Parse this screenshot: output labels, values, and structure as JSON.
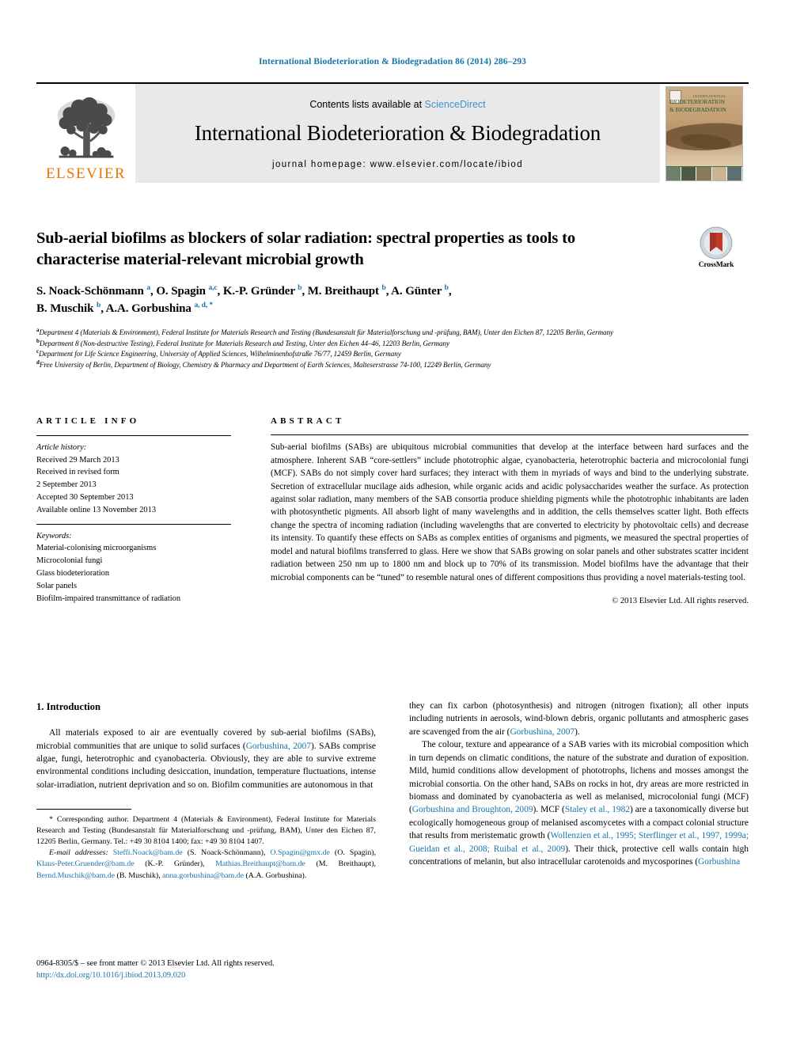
{
  "running_head": "International Biodeterioration & Biodegradation 86 (2014) 286–293",
  "masthead": {
    "publisher_wordmark": "ELSEVIER",
    "contents_prefix": "Contents lists available at ",
    "contents_link": "ScienceDirect",
    "journal_name": "International Biodeterioration & Biodegradation",
    "homepage": "journal homepage: www.elsevier.com/locate/ibiod",
    "cover_title_top": "INTERNATIONAL",
    "cover_title_line1": "BIODETERIORATION",
    "cover_title_line2": "& BIODEGRADATION"
  },
  "crossmark": {
    "label": "CrossMark"
  },
  "article": {
    "title": "Sub-aerial biofilms as blockers of solar radiation: spectral properties as tools to characterise material-relevant microbial growth",
    "authors_line1_html": "S. Noack-Schönmann <sup>a</sup>, O. Spagin <sup>a,c</sup>, K.-P. Gründer <sup>b</sup>, M. Breithaupt <sup>b</sup>, A. Günter <sup>b</sup>,",
    "authors_line2_html": "B. Muschik <sup>b</sup>, A.A. Gorbushina <sup>a, d, *</sup>",
    "affiliations": [
      {
        "marker": "a",
        "text": "Department 4 (Materials & Environment), Federal Institute for Materials Research and Testing (Bundesanstalt für Materialforschung und -prüfung, BAM), Unter den Eichen 87, 12205 Berlin, Germany"
      },
      {
        "marker": "b",
        "text": "Department 8 (Non-destructive Testing), Federal Institute for Materials Research and Testing, Unter den Eichen 44–46, 12203 Berlin, Germany"
      },
      {
        "marker": "c",
        "text": "Department for Life Science Engineering, University of Applied Sciences, Wilhelminenhofstraße 76/77, 12459 Berlin, Germany"
      },
      {
        "marker": "d",
        "text": "Free University of Berlin, Department of Biology, Chemistry & Pharmacy and Department of Earth Sciences, Malteserstrasse 74-100, 12249 Berlin, Germany"
      }
    ]
  },
  "article_info": {
    "heading": "ARTICLE INFO",
    "history_label": "Article history:",
    "history": [
      "Received 29 March 2013",
      "Received in revised form",
      "2 September 2013",
      "Accepted 30 September 2013",
      "Available online 13 November 2013"
    ],
    "keywords_label": "Keywords:",
    "keywords": [
      "Material-colonising microorganisms",
      "Microcolonial fungi",
      "Glass biodeterioration",
      "Solar panels",
      "Biofilm-impaired transmittance of radiation"
    ]
  },
  "abstract": {
    "heading": "ABSTRACT",
    "text": "Sub-aerial biofilms (SABs) are ubiquitous microbial communities that develop at the interface between hard surfaces and the atmosphere. Inherent SAB “core-settlers” include phototrophic algae, cyanobacteria, heterotrophic bacteria and microcolonial fungi (MCF). SABs do not simply cover hard surfaces; they interact with them in myriads of ways and bind to the underlying substrate. Secretion of extracellular mucilage aids adhesion, while organic acids and acidic polysaccharides weather the surface. As protection against solar radiation, many members of the SAB consortia produce shielding pigments while the phototrophic inhabitants are laden with photosynthetic pigments. All absorb light of many wavelengths and in addition, the cells themselves scatter light. Both effects change the spectra of incoming radiation (including wavelengths that are converted to electricity by photovoltaic cells) and decrease its intensity. To quantify these effects on SABs as complex entities of organisms and pigments, we measured the spectral properties of model and natural biofilms transferred to glass. Here we show that SABs growing on solar panels and other substrates scatter incident radiation between 250 nm up to 1800 nm and block up to 70% of its transmission. Model biofilms have the advantage that their microbial components can be “tuned” to resemble natural ones of different compositions thus providing a novel materials-testing tool.",
    "copyright": "© 2013 Elsevier Ltd. All rights reserved."
  },
  "body": {
    "section_number_title": "1. Introduction",
    "left_paragraph_1_pre": "All materials exposed to air are eventually covered by sub-aerial biofilms (SABs), microbial communities that are unique to solid surfaces (",
    "left_paragraph_1_cite": "Gorbushina, 2007",
    "left_paragraph_1_post": "). SABs comprise algae, fungi, heterotrophic and cyanobacteria. Obviously, they are able to survive extreme environmental conditions including desiccation, inundation, temperature fluctuations, intense solar-irradiation, nutrient deprivation and so on. Biofilm communities are autonomous in that",
    "right_paragraph_1_pre": "they can fix carbon (photosynthesis) and nitrogen (nitrogen fixation); all other inputs including nutrients in aerosols, wind-blown debris, organic pollutants and atmospheric gases are scavenged from the air (",
    "right_paragraph_1_cite": "Gorbushina, 2007",
    "right_paragraph_1_post": ").",
    "right_paragraph_2_part1": "The colour, texture and appearance of a SAB varies with its microbial composition which in turn depends on climatic conditions, the nature of the substrate and duration of exposition. Mild, humid conditions allow development of phototrophs, lichens and mosses amongst the microbial consortia. On the other hand, SABs on rocks in hot, dry areas are more restricted in biomass and dominated by cyanobacteria as well as melanised, microcolonial fungi (MCF) (",
    "right_cite_1": "Gorbushina and Broughton, 2009",
    "right_paragraph_2_part2": "). MCF (",
    "right_cite_2": "Staley et al., 1982",
    "right_paragraph_2_part3": ") are a taxonomically diverse but ecologically homogeneous group of melanised ascomycetes with a compact colonial structure that results from meristematic growth (",
    "right_cite_3": "Wollenzien et al., 1995; Sterflinger et al., 1997, 1999a; Gueidan et al., 2008; Ruibal et al., 2009",
    "right_paragraph_2_part4": "). Their thick, protective cell walls contain high concentrations of melanin, but also intracellular carotenoids and mycosporines (",
    "right_cite_4": "Gorbushina"
  },
  "correspondence": {
    "star": "*",
    "text": "Corresponding author. Department 4 (Materials & Environment), Federal Institute for Materials Research and Testing (Bundesanstalt für Materialforschung und -prüfung, BAM), Unter den Eichen 87, 12205 Berlin, Germany. Tel.: +49 30 8104 1400; fax: +49 30 8104 1407.",
    "email_label": "E-mail addresses:",
    "emails": [
      {
        "address": "Steffi.Noack@bam.de",
        "person": "(S. Noack-Schönmann)"
      },
      {
        "address": "O.Spagin@gmx.de",
        "person": "(O. Spagin)"
      },
      {
        "address": "Klaus-Peter.Gruender@bam.de",
        "person": "(K.-P. Gründer)"
      },
      {
        "address": "Mathias.Breithaupt@bam.de",
        "person": "(M. Breithaupt)"
      },
      {
        "address": "Bernd.Muschik@bam.de",
        "person": "(B. Muschik)"
      },
      {
        "address": "anna.gorbushina@bam.de",
        "person": "(A.A. Gorbushina)"
      }
    ]
  },
  "footer": {
    "issn_line": "0964-8305/$ – see front matter © 2013 Elsevier Ltd. All rights reserved.",
    "doi": "http://dx.doi.org/10.1016/j.ibiod.2013.09.020"
  },
  "colors": {
    "link_blue": "#1675a8",
    "sciencedirect_blue": "#3a92cf",
    "elsevier_orange": "#ec7404",
    "band_grey": "#e9e9e9"
  }
}
